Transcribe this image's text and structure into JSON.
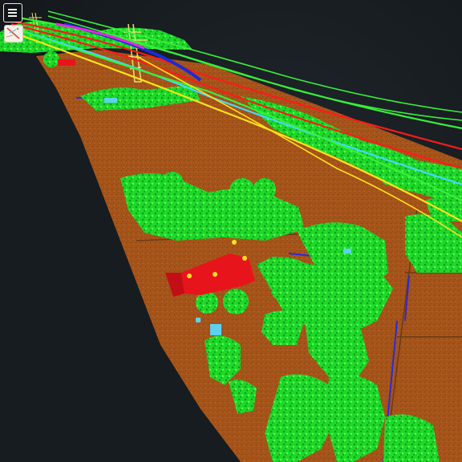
{
  "app": {
    "menu_icon": "hamburger-menu-icon",
    "thumbnail_icon": "map-thumbnail-icon"
  },
  "palette": {
    "background": "#161b1f",
    "ground": "#a8561a",
    "vegetation": "#22e02b",
    "building": "#e8141c",
    "powerline_red": "#ff1a1a",
    "powerline_blue": "#1a2bd8",
    "powerline_cyan": "#44d8ff",
    "powerline_yellow": "#ffe21a",
    "powerline_green": "#38ef3a",
    "pylon": "#e6e070",
    "water": "#5ad2f0",
    "unclassified_blue": "#2a2bd8"
  }
}
